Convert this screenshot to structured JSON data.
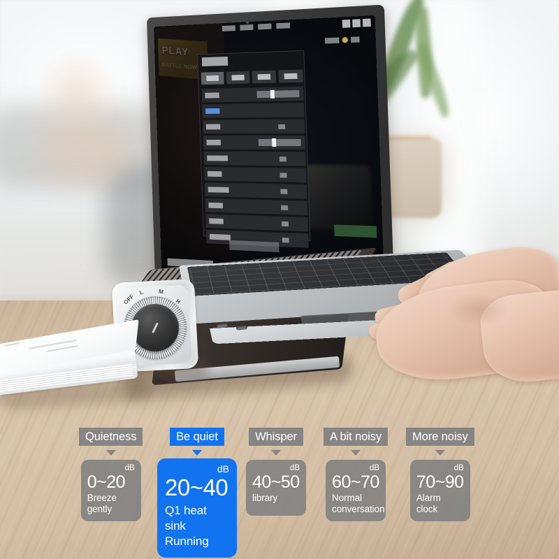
{
  "scene": {
    "product_dial": {
      "labels": [
        "OFF",
        "L",
        "M",
        "H"
      ]
    },
    "laptop_screen": {
      "game_banner_title": "PLAY",
      "game_banner_subtitle": "BATTLE NOW"
    }
  },
  "noise_scale": {
    "columns": [
      {
        "chip_label": "Quietness",
        "active": false,
        "unit": "dB",
        "range": "0~20",
        "description": "Breeze gently"
      },
      {
        "chip_label": "Be quiet",
        "active": true,
        "unit": "dB",
        "range": "20~40",
        "description": "Q1 heat sink Running"
      },
      {
        "chip_label": "Whisper",
        "active": false,
        "unit": "dB",
        "range": "40~50",
        "description": "library"
      },
      {
        "chip_label": "A bit noisy",
        "active": false,
        "unit": "dB",
        "range": "60~70",
        "description": "Normal conversation"
      },
      {
        "chip_label": "More noisy",
        "active": false,
        "unit": "dB",
        "range": "70~90",
        "description": "Alarm clock"
      }
    ]
  },
  "colors": {
    "accent_blue": "#1273f0",
    "chip_gray": "#808080",
    "text_white": "#ffffff",
    "desk_wood": "#d3be a4"
  }
}
